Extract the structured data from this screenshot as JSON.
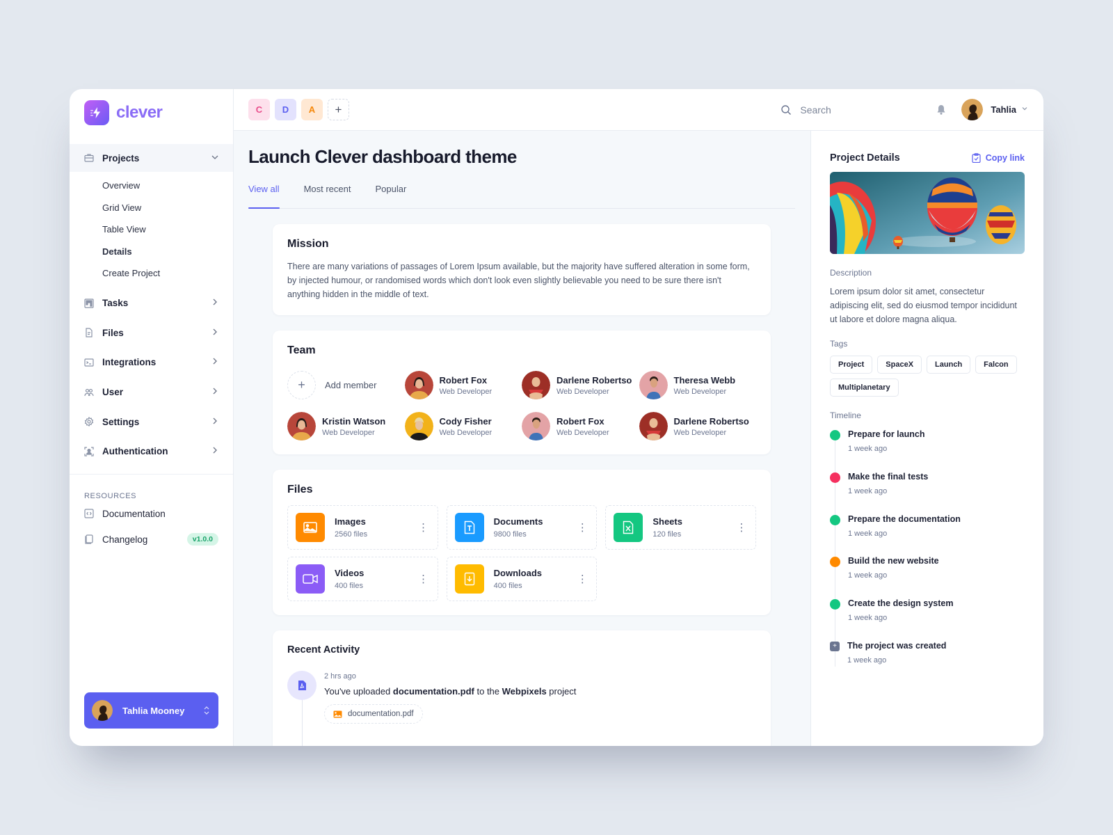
{
  "brand": {
    "name": "clever"
  },
  "sidebar": {
    "projects": {
      "label": "Projects",
      "expanded": true
    },
    "project_subitems": [
      {
        "label": "Overview",
        "current": false
      },
      {
        "label": "Grid View",
        "current": false
      },
      {
        "label": "Table View",
        "current": false
      },
      {
        "label": "Details",
        "current": true
      },
      {
        "label": "Create Project",
        "current": false
      }
    ],
    "items": [
      {
        "label": "Tasks",
        "icon": "kanban-icon"
      },
      {
        "label": "Files",
        "icon": "file-icon"
      },
      {
        "label": "Integrations",
        "icon": "terminal-icon"
      },
      {
        "label": "User",
        "icon": "users-icon"
      },
      {
        "label": "Settings",
        "icon": "gear-icon"
      },
      {
        "label": "Authentication",
        "icon": "user-scan-icon"
      }
    ],
    "resources_title": "RESOURCES",
    "resources": [
      {
        "label": "Documentation",
        "icon": "code-icon"
      },
      {
        "label": "Changelog",
        "icon": "copy-icon",
        "badge": "v1.0.0"
      }
    ],
    "user": {
      "name": "Tahlia Mooney"
    }
  },
  "topbar": {
    "workspaces": [
      "C",
      "D",
      "A"
    ],
    "add_workspace": "+",
    "search_placeholder": "Search",
    "user_name": "Tahlia"
  },
  "page": {
    "title": "Launch Clever dashboard theme",
    "tabs": [
      {
        "label": "View all",
        "active": true
      },
      {
        "label": "Most recent",
        "active": false
      },
      {
        "label": "Popular",
        "active": false
      }
    ]
  },
  "mission": {
    "title": "Mission",
    "text": "There are many variations of passages of Lorem Ipsum available, but the majority have suffered alteration in some form, by injected humour, or randomised words which don't look even slightly believable you need to be sure there isn't anything hidden in the middle of text."
  },
  "team": {
    "title": "Team",
    "add_label": "Add member",
    "members": [
      {
        "name": "Robert Fox",
        "role": "Web Developer"
      },
      {
        "name": "Darlene Robertso",
        "role": "Web Developer"
      },
      {
        "name": "Theresa Webb",
        "role": "Web Developer"
      },
      {
        "name": "Kristin Watson",
        "role": "Web Developer"
      },
      {
        "name": "Cody Fisher",
        "role": "Web Developer"
      },
      {
        "name": "Robert Fox",
        "role": "Web Developer"
      },
      {
        "name": "Darlene Robertso",
        "role": "Web Developer"
      }
    ]
  },
  "files": {
    "title": "Files",
    "items": [
      {
        "name": "Images",
        "count": "2560 files",
        "color": "#ff8a00",
        "icon": "image-icon"
      },
      {
        "name": "Documents",
        "count": "9800 files",
        "color": "#1a9bff",
        "icon": "text-file-icon"
      },
      {
        "name": "Sheets",
        "count": "120 files",
        "color": "#14c781",
        "icon": "spreadsheet-icon"
      },
      {
        "name": "Videos",
        "count": "400 files",
        "color": "#8b5cf6",
        "icon": "video-icon"
      },
      {
        "name": "Downloads",
        "count": "400 files",
        "color": "#ffbb00",
        "icon": "download-icon"
      }
    ]
  },
  "activity": {
    "title": "Recent Activity",
    "items": [
      {
        "when": "2 hrs ago",
        "prefix": "You've uploaded ",
        "file": "documentation.pdf",
        "middle": " to the ",
        "project": "Webpixels",
        "suffix": " project",
        "attachment": "documentation.pdf"
      }
    ]
  },
  "details": {
    "title": "Project Details",
    "copy_link": "Copy link",
    "description_label": "Description",
    "description": "Lorem ipsum dolor sit amet, consectetur adipiscing elit, sed do eiusmod tempor incididunt ut labore et dolore magna aliqua.",
    "tags_label": "Tags",
    "tags": [
      "Project",
      "SpaceX",
      "Launch",
      "Falcon",
      "Multiplanetary"
    ],
    "timeline_label": "Timeline",
    "timeline": [
      {
        "title": "Prepare for launch",
        "when": "1 week ago",
        "color": "#14c781"
      },
      {
        "title": "Make the final tests",
        "when": "1 week ago",
        "color": "#f5305f"
      },
      {
        "title": "Prepare the documentation",
        "when": "1 week ago",
        "color": "#14c781"
      },
      {
        "title": "Build the new website",
        "when": "1 week ago",
        "color": "#ff8a00"
      },
      {
        "title": "Create the design system",
        "when": "1 week ago",
        "color": "#14c781"
      },
      {
        "title": "The project was created",
        "when": "1 week ago",
        "color": "#6b7590",
        "calendar": true
      }
    ]
  }
}
